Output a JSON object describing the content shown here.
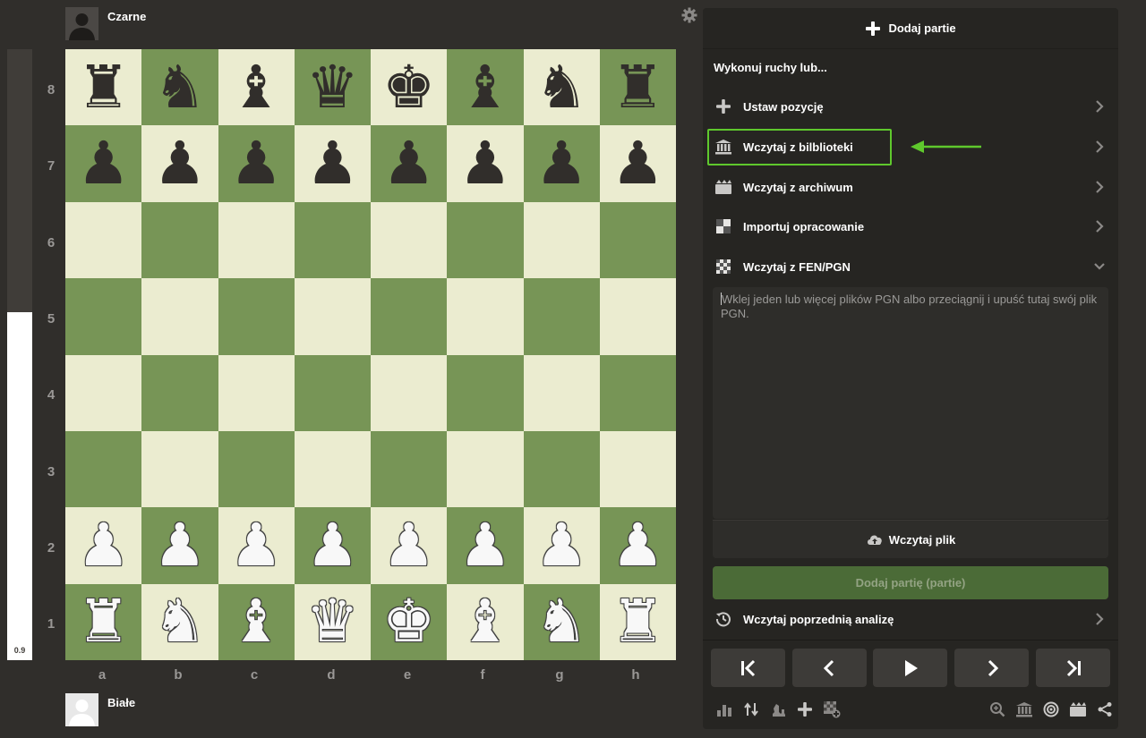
{
  "eval_bar": {
    "score": "0.9",
    "white_fraction": 0.57
  },
  "players": {
    "top": "Czarne",
    "bottom": "Białe"
  },
  "board": {
    "ranks": [
      "8",
      "7",
      "6",
      "5",
      "4",
      "3",
      "2",
      "1"
    ],
    "files": [
      "a",
      "b",
      "c",
      "d",
      "e",
      "f",
      "g",
      "h"
    ],
    "position": [
      [
        "r",
        "n",
        "b",
        "q",
        "k",
        "b",
        "n",
        "r"
      ],
      [
        "p",
        "p",
        "p",
        "p",
        "p",
        "p",
        "p",
        "p"
      ],
      [
        "",
        "",
        "",
        "",
        "",
        "",
        "",
        ""
      ],
      [
        "",
        "",
        "",
        "",
        "",
        "",
        "",
        ""
      ],
      [
        "",
        "",
        "",
        "",
        "",
        "",
        "",
        ""
      ],
      [
        "",
        "",
        "",
        "",
        "",
        "",
        "",
        ""
      ],
      [
        "P",
        "P",
        "P",
        "P",
        "P",
        "P",
        "P",
        "P"
      ],
      [
        "R",
        "N",
        "B",
        "Q",
        "K",
        "B",
        "N",
        "R"
      ]
    ]
  },
  "panel": {
    "add_game": "Dodaj partie",
    "intro": "Wykonuj ruchy lub...",
    "items": [
      {
        "label": "Ustaw pozycję",
        "icon": "plus-icon"
      },
      {
        "label": "Wczytaj z bilblioteki",
        "icon": "library-icon"
      },
      {
        "label": "Wczytaj z archiwum",
        "icon": "archive-icon"
      },
      {
        "label": "Importuj opracowanie",
        "icon": "study-icon"
      },
      {
        "label": "Wczytaj z FEN/PGN",
        "icon": "board-icon"
      }
    ],
    "pgn_placeholder": "Wklej jeden lub więcej plików PGN albo przeciągnij i upuść tutaj swój plik PGN.",
    "load_file": "Wczytaj plik",
    "add_games_button": "Dodaj partię (partie)",
    "previous_analysis": "Wczytaj poprzednią analizę"
  },
  "colors": {
    "highlight": "#5fc82d",
    "light_square": "#ebecd0",
    "dark_square": "#779556",
    "add_button": "#4b6b37"
  },
  "nav_buttons": [
    "first-move-icon",
    "previous-move-icon",
    "play-icon",
    "next-move-icon",
    "last-move-icon"
  ],
  "tools_left": [
    "chart-icon",
    "flip-board-icon",
    "pieces-icon",
    "plus-icon",
    "add-board-icon"
  ],
  "tools_right": [
    "zoom-icon",
    "library-icon",
    "target-icon",
    "archive-icon",
    "share-icon"
  ]
}
